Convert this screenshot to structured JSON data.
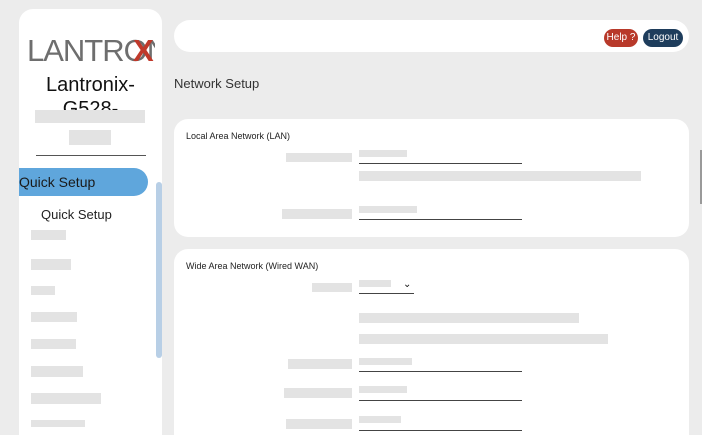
{
  "sidebar": {
    "logo_text": "LANTRONIX",
    "device_name": "Lantronix-\nG528-",
    "active_item": "Quick Setup",
    "sub_item": "Quick Setup"
  },
  "header": {
    "help_label": "Help ?",
    "logout_label": "Logout"
  },
  "page": {
    "title": "Network Setup",
    "lan_title": "Local Area Network (LAN)",
    "wan_title": "Wide Area Network (Wired WAN)"
  },
  "colors": {
    "active_item": "#5fa6dc",
    "help_button": "#b8392a",
    "logout_button": "#1e3d5c",
    "logo_accent": "#c0392b"
  },
  "icons": {
    "wan_select": "chevron-down-icon"
  }
}
